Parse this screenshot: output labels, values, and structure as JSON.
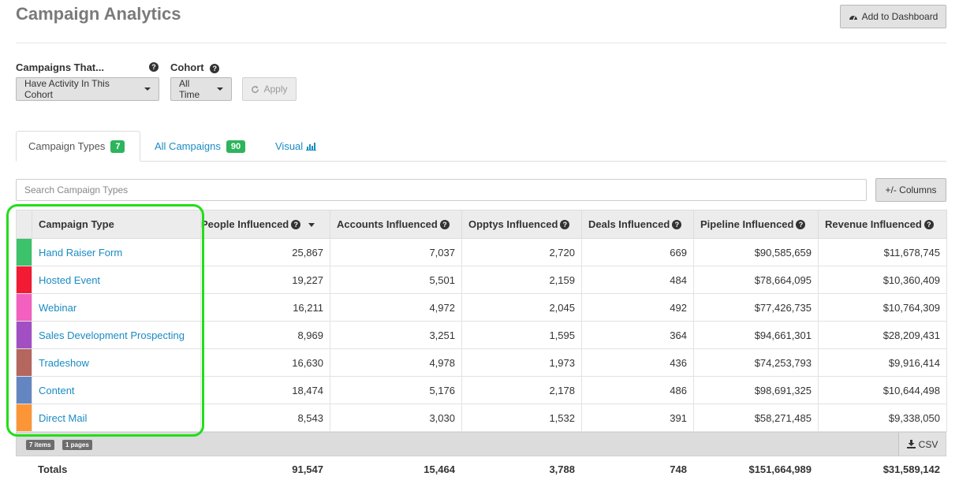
{
  "header": {
    "title": "Campaign Analytics",
    "add_dashboard": "Add to Dashboard"
  },
  "filters": {
    "campaigns_label": "Campaigns That...",
    "campaigns_value": "Have Activity In This Cohort",
    "cohort_label": "Cohort",
    "cohort_value": "All Time",
    "apply_label": "Apply"
  },
  "tabs": [
    {
      "label": "Campaign Types",
      "count": "7"
    },
    {
      "label": "All Campaigns",
      "count": "90"
    },
    {
      "label": "Visual"
    }
  ],
  "search": {
    "placeholder": "Search Campaign Types"
  },
  "columns_button": "+/- Columns",
  "table": {
    "headers": [
      "Campaign Type",
      "People Influenced",
      "Accounts Influenced",
      "Opptys Influenced",
      "Deals Influenced",
      "Pipeline Influenced",
      "Revenue Influenced"
    ],
    "rows": [
      {
        "color": "#3cc26a",
        "name": "Hand Raiser Form",
        "people": "25,867",
        "accounts": "7,037",
        "opptys": "2,720",
        "deals": "669",
        "pipeline": "$90,585,659",
        "revenue": "$11,678,745"
      },
      {
        "color": "#f31a33",
        "name": "Hosted Event",
        "people": "19,227",
        "accounts": "5,501",
        "opptys": "2,159",
        "deals": "484",
        "pipeline": "$78,664,095",
        "revenue": "$10,360,409"
      },
      {
        "color": "#f460c0",
        "name": "Webinar",
        "people": "16,211",
        "accounts": "4,972",
        "opptys": "2,045",
        "deals": "492",
        "pipeline": "$77,426,735",
        "revenue": "$10,764,309"
      },
      {
        "color": "#a34fc4",
        "name": "Sales Development Prospecting",
        "people": "8,969",
        "accounts": "3,251",
        "opptys": "1,595",
        "deals": "364",
        "pipeline": "$94,661,301",
        "revenue": "$28,209,431"
      },
      {
        "color": "#b5665e",
        "name": "Tradeshow",
        "people": "16,630",
        "accounts": "4,978",
        "opptys": "1,973",
        "deals": "436",
        "pipeline": "$74,253,793",
        "revenue": "$9,916,414"
      },
      {
        "color": "#6386c2",
        "name": "Content",
        "people": "18,474",
        "accounts": "5,176",
        "opptys": "2,178",
        "deals": "486",
        "pipeline": "$98,691,325",
        "revenue": "$10,644,498"
      },
      {
        "color": "#fc9536",
        "name": "Direct Mail",
        "people": "8,543",
        "accounts": "3,030",
        "opptys": "1,532",
        "deals": "391",
        "pipeline": "$58,271,485",
        "revenue": "$9,338,050"
      }
    ]
  },
  "pager": {
    "items": "7 items",
    "pages": "1 pages",
    "csv": "CSV"
  },
  "totals": {
    "label": "Totals",
    "people": "91,547",
    "accounts": "15,464",
    "opptys": "3,788",
    "deals": "748",
    "pipeline": "$151,664,989",
    "revenue": "$31,589,142"
  },
  "icons": {
    "help": "question-circle-icon",
    "dashboard": "dashboard-icon",
    "refresh": "refresh-icon",
    "chart": "bar-chart-icon",
    "download": "download-icon"
  },
  "colors": {
    "link": "#1a8bc4",
    "badge": "#2db45c",
    "highlight": "#22dd1a"
  }
}
